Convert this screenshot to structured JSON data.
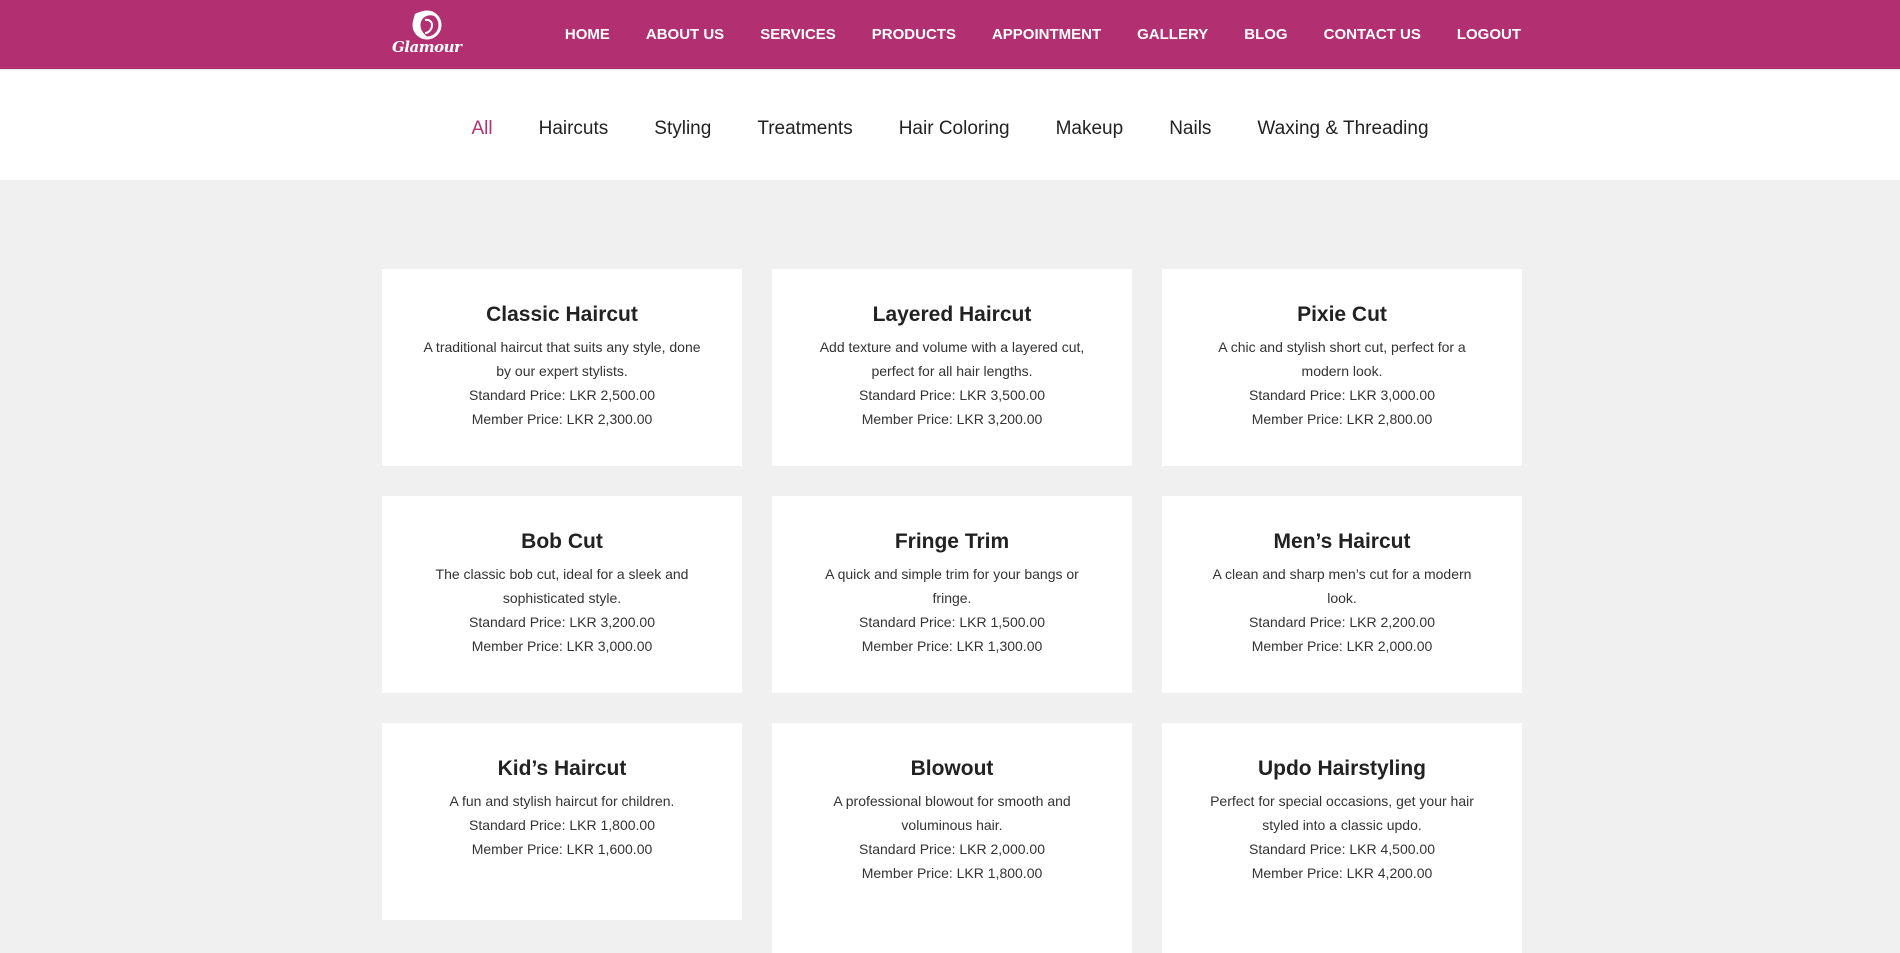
{
  "brand": {
    "name": "Glamour",
    "accent": "#b22f72"
  },
  "nav": [
    {
      "label": "HOME"
    },
    {
      "label": "ABOUT US"
    },
    {
      "label": "SERVICES"
    },
    {
      "label": "PRODUCTS"
    },
    {
      "label": "APPOINTMENT"
    },
    {
      "label": "GALLERY"
    },
    {
      "label": "BLOG"
    },
    {
      "label": "CONTACT US"
    },
    {
      "label": "LOGOUT"
    }
  ],
  "filters": [
    {
      "label": "All",
      "active": true
    },
    {
      "label": "Haircuts"
    },
    {
      "label": "Styling"
    },
    {
      "label": "Treatments"
    },
    {
      "label": "Hair Coloring"
    },
    {
      "label": "Makeup"
    },
    {
      "label": "Nails"
    },
    {
      "label": "Waxing & Threading"
    }
  ],
  "services": [
    {
      "title": "Classic Haircut",
      "desc": "A traditional haircut that suits any style, done by our expert stylists.",
      "standard": "Standard Price: LKR 2,500.00",
      "member": "Member Price: LKR 2,300.00"
    },
    {
      "title": "Layered Haircut",
      "desc": "Add texture and volume with a layered cut, perfect for all hair lengths.",
      "standard": "Standard Price: LKR 3,500.00",
      "member": "Member Price: LKR 3,200.00"
    },
    {
      "title": "Pixie Cut",
      "desc": "A chic and stylish short cut, perfect for a modern look.",
      "standard": "Standard Price: LKR 3,000.00",
      "member": "Member Price: LKR 2,800.00"
    },
    {
      "title": "Bob Cut",
      "desc": "The classic bob cut, ideal for a sleek and sophisticated style.",
      "standard": "Standard Price: LKR 3,200.00",
      "member": "Member Price: LKR 3,000.00"
    },
    {
      "title": "Fringe Trim",
      "desc": "A quick and simple trim for your bangs or fringe.",
      "standard": "Standard Price: LKR 1,500.00",
      "member": "Member Price: LKR 1,300.00"
    },
    {
      "title": "Men’s Haircut",
      "desc": "A clean and sharp men’s cut for a modern look.",
      "standard": "Standard Price: LKR 2,200.00",
      "member": "Member Price: LKR 2,000.00"
    },
    {
      "title": "Kid’s Haircut",
      "desc": "A fun and stylish haircut for children.",
      "standard": "Standard Price: LKR 1,800.00",
      "member": "Member Price: LKR 1,600.00"
    },
    {
      "title": "Blowout",
      "desc": "A professional blowout for smooth and voluminous hair.",
      "standard": "Standard Price: LKR 2,000.00",
      "member": "Member Price: LKR 1,800.00"
    },
    {
      "title": "Updo Hairstyling",
      "desc": "Perfect for special occasions, get your hair styled into a classic updo.",
      "standard": "Standard Price: LKR 4,500.00",
      "member": "Member Price: LKR 4,200.00"
    }
  ]
}
